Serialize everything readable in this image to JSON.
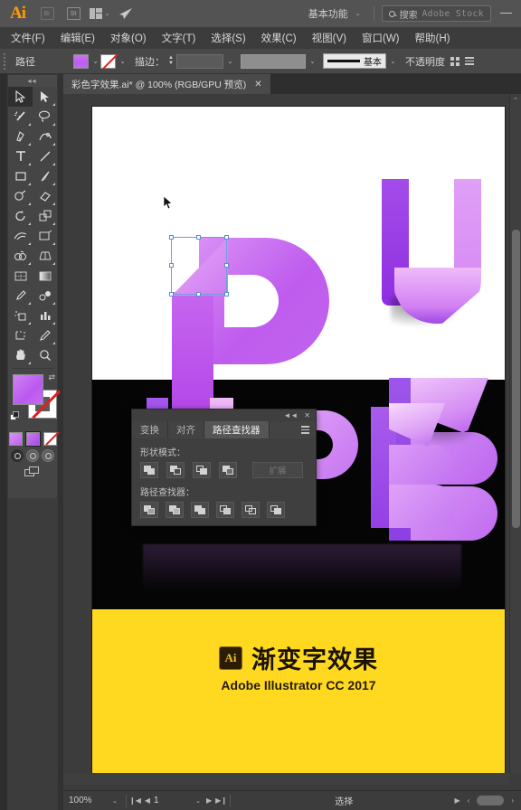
{
  "app": {
    "logo": "Ai",
    "workspace": "基本功能",
    "search_label": "搜索",
    "search_brand": "Adobe Stock",
    "minimize": "—"
  },
  "menubar": {
    "items": [
      {
        "label": "文件(F)"
      },
      {
        "label": "编辑(E)"
      },
      {
        "label": "对象(O)"
      },
      {
        "label": "文字(T)"
      },
      {
        "label": "选择(S)"
      },
      {
        "label": "效果(C)"
      },
      {
        "label": "视图(V)"
      },
      {
        "label": "窗口(W)"
      },
      {
        "label": "帮助(H)"
      }
    ]
  },
  "controlbar": {
    "object_label": "路径",
    "fill_color": "#c06bee",
    "stroke_color": "none",
    "stroke_label": "描边：",
    "stroke_weight": "",
    "profile": "",
    "brush_label": "基本",
    "opacity_label": "不透明度",
    "chevron": "⌄"
  },
  "document_tab": {
    "title": "彩色字效果.ai* @ 100% (RGB/GPU 预览)",
    "close": "✕"
  },
  "toolbox": {
    "handle": "⌃⌃",
    "tools": [
      {
        "name": "selection-tool",
        "label": "选择工具",
        "active": true
      },
      {
        "name": "direct-selection-tool",
        "label": "直接选择工具",
        "active": false
      },
      {
        "name": "magic-wand-tool",
        "label": "魔棒工具",
        "active": false
      },
      {
        "name": "lasso-tool",
        "label": "套索工具",
        "active": false
      },
      {
        "name": "pen-tool",
        "label": "钢笔工具",
        "active": false
      },
      {
        "name": "curvature-tool",
        "label": "曲率工具",
        "active": false
      },
      {
        "name": "type-tool",
        "label": "文字工具",
        "active": false
      },
      {
        "name": "line-segment-tool",
        "label": "直线段工具",
        "active": false
      },
      {
        "name": "rectangle-tool",
        "label": "矩形工具",
        "active": false
      },
      {
        "name": "paintbrush-tool",
        "label": "画笔工具",
        "active": false
      },
      {
        "name": "pencil-tool",
        "label": "铅笔工具",
        "active": false
      },
      {
        "name": "eraser-tool",
        "label": "橡皮擦工具",
        "active": false
      },
      {
        "name": "rotate-tool",
        "label": "旋转工具",
        "active": false
      },
      {
        "name": "scale-tool",
        "label": "比例缩放工具",
        "active": false
      },
      {
        "name": "width-tool",
        "label": "宽度工具",
        "active": false
      },
      {
        "name": "free-transform-tool",
        "label": "自由变换工具",
        "active": false
      },
      {
        "name": "shape-builder-tool",
        "label": "形状生成器工具",
        "active": false
      },
      {
        "name": "perspective-grid-tool",
        "label": "透视网格工具",
        "active": false
      },
      {
        "name": "mesh-tool",
        "label": "网格工具",
        "active": false
      },
      {
        "name": "gradient-tool",
        "label": "渐变工具",
        "active": false
      },
      {
        "name": "eyedropper-tool",
        "label": "吸管工具",
        "active": false
      },
      {
        "name": "blend-tool",
        "label": "混合工具",
        "active": false
      },
      {
        "name": "symbol-sprayer-tool",
        "label": "符号喷枪工具",
        "active": false
      },
      {
        "name": "column-graph-tool",
        "label": "柱形图工具",
        "active": false
      },
      {
        "name": "artboard-tool",
        "label": "画板工具",
        "active": false
      },
      {
        "name": "slice-tool",
        "label": "切片工具",
        "active": false
      },
      {
        "name": "hand-tool",
        "label": "抓手工具",
        "active": false
      },
      {
        "name": "zoom-tool",
        "label": "缩放工具",
        "active": false
      }
    ],
    "fill_gradient_from": "#cd84f2",
    "fill_gradient_to": "#bb58ef",
    "stroke": "none",
    "swatches": [
      "#c97ef0",
      "#b45cec",
      "none"
    ],
    "draw_modes": [
      "正常绘图",
      "背面绘图",
      "内部绘图"
    ],
    "screen_mode": "更改屏幕模式"
  },
  "pathfinder_panel": {
    "collapse": "◄◄",
    "close": "✕",
    "tabs": [
      {
        "label": "变换",
        "active": false
      },
      {
        "label": "对齐",
        "active": false
      },
      {
        "label": "路径查找器",
        "active": true
      }
    ],
    "shape_modes_label": "形状模式：",
    "shape_modes": [
      {
        "name": "unite",
        "label": "联集"
      },
      {
        "name": "minus-front",
        "label": "减去顶层"
      },
      {
        "name": "intersect",
        "label": "交集"
      },
      {
        "name": "exclude",
        "label": "差集"
      }
    ],
    "expand_label": "扩展",
    "pathfinders_label": "路径查找器：",
    "pathfinders": [
      {
        "name": "divide",
        "label": "分割"
      },
      {
        "name": "trim",
        "label": "修边"
      },
      {
        "name": "merge",
        "label": "合并"
      },
      {
        "name": "crop",
        "label": "裁剪"
      },
      {
        "name": "outline",
        "label": "轮廓"
      },
      {
        "name": "minus-back",
        "label": "减去后方对象"
      }
    ]
  },
  "artwork": {
    "banner_badge": "Ai",
    "banner_title": "渐变字效果",
    "banner_subtitle": "Adobe Illustrator CC 2017",
    "letters": "UPB",
    "accent_purple": "#bd5cee",
    "accent_light": "#e6a8f7",
    "banner_bg": "#ffd91f"
  },
  "statusbar": {
    "zoom": "100%",
    "zoom_chevron": "⌄",
    "first": "❙◀",
    "prev": "◀",
    "page": "1",
    "page_chevron": "⌄",
    "next": "▶",
    "last": "▶❙",
    "status_text": "选择",
    "play": "▶",
    "left": "‹",
    "right": "›"
  }
}
